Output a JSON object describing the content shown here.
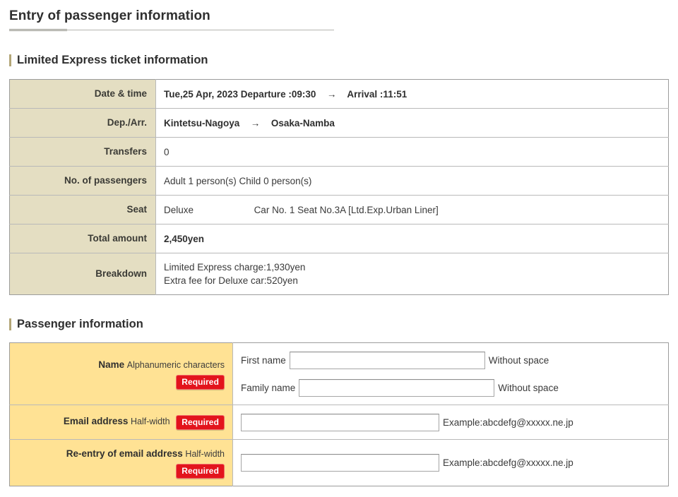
{
  "page": {
    "title": "Entry of passenger information"
  },
  "ticket_section": {
    "heading": "Limited Express ticket information",
    "rows": [
      {
        "label": "Date & time",
        "value": "Tue,25 Apr, 2023 Departure :09:30",
        "arrow": "→",
        "value2": "Arrival :11:51"
      },
      {
        "label": "Dep./Arr.",
        "value": "Kintetsu-Nagoya",
        "arrow": "→",
        "value2": "Osaka-Namba"
      },
      {
        "label": "Transfers",
        "value": "0"
      },
      {
        "label": "No. of passengers",
        "value": "Adult 1 person(s)  Child 0 person(s)"
      },
      {
        "label": "Seat",
        "value": "Deluxe",
        "value2": "Car No. 1  Seat No.3A [Ltd.Exp.Urban Liner]"
      },
      {
        "label": "Total amount",
        "value": "2,450yen"
      },
      {
        "label": "Breakdown",
        "line1": "Limited Express charge:1,930yen",
        "line2": "Extra fee for Deluxe car:520yen"
      }
    ]
  },
  "passenger_section": {
    "heading": "Passenger information",
    "required_badge": "Required",
    "rows": {
      "name": {
        "label_main": "Name",
        "label_sub": "Alphanumeric characters",
        "first_name_label": "First name",
        "first_name_value": "",
        "first_name_note": "Without space",
        "family_name_label": "Family name",
        "family_name_value": "",
        "family_name_note": "Without space"
      },
      "email": {
        "label_main": "Email address",
        "label_sub": "Half-width",
        "value": "",
        "note": "Example:abcdefg@xxxxx.ne.jp"
      },
      "email_confirm": {
        "label_main": "Re-entry of email address",
        "label_sub": "Half-width",
        "value": "",
        "note": "Example:abcdefg@xxxxx.ne.jp"
      }
    }
  },
  "colors": {
    "ticket_label_bg": "#e4dec2",
    "passenger_label_bg": "#ffe294",
    "required_red": "#e3141c",
    "heading_bar": "#b3a678",
    "text": "#333333",
    "border": "#b9b9b9"
  }
}
